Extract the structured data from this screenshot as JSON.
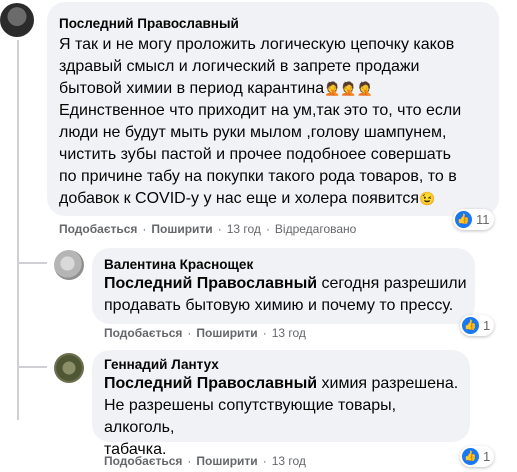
{
  "comments": [
    {
      "author": "Последний Православный",
      "lines": [
        "Я так и не могу проложить логическую цепочку каков",
        "здравый смысл и логический в запрете продажи",
        "бытовой химии в период карантина",
        "Единственное что приходит на ум,так это то, что если",
        "люди не будут мыть руки мылом ,голову шампунем,",
        "чистить зубы пастой и прочее подобноее совершать",
        "по причине табу на покупки такого рода товаров, то в",
        "добавок к COVID-у у нас еще и холера появится"
      ],
      "emoji_line3": "🤦🤦🤦",
      "emoji_end": "😉",
      "actions": {
        "like": "Подобається",
        "reply": "Поширити",
        "time": "13 год",
        "edited": "Відредаговано"
      },
      "reaction_count": "11"
    },
    {
      "author": "Валентина Краснощек",
      "mention": "Последний Православный",
      "text_first": " сегодня разрешили",
      "text_second": "продавать бытовую химию и почему то прессу.",
      "actions": {
        "like": "Подобається",
        "reply": "Поширити",
        "time": "13 год"
      },
      "reaction_count": "1"
    },
    {
      "author": "Геннадий Лантух",
      "mention": "Последний Православный",
      "text_first": " химия разрешена.",
      "text_second": "Не разрешены сопутствующие товары, алкоголь,",
      "text_third": "табачка.",
      "actions": {
        "like": "Подобається",
        "reply": "Поширити",
        "time": "13 год"
      },
      "reaction_count": "1"
    }
  ],
  "icons": {
    "like": "thumbs-up-icon"
  },
  "colors": {
    "bubble": "#f0f2f5",
    "meta": "#65676b",
    "like": "#1877f2"
  }
}
